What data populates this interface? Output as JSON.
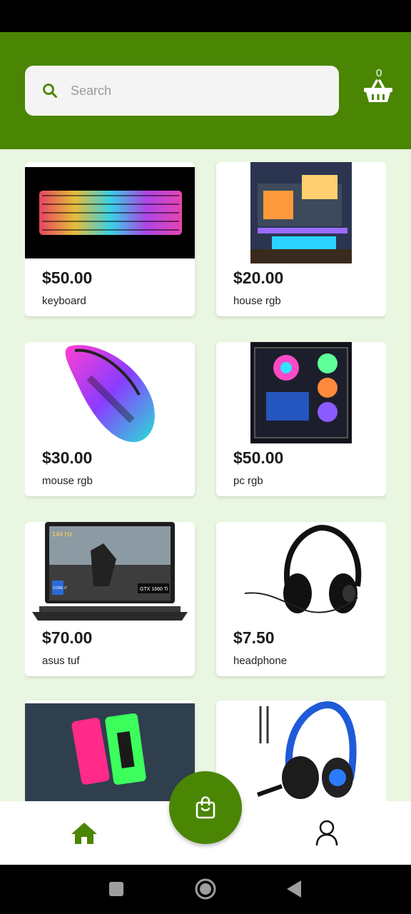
{
  "search": {
    "placeholder": "Search",
    "value": ""
  },
  "cart": {
    "count": "0"
  },
  "products": [
    {
      "price": "$50.00",
      "name": "keyboard"
    },
    {
      "price": "$20.00",
      "name": "house rgb"
    },
    {
      "price": "$30.00",
      "name": "mouse rgb"
    },
    {
      "price": "$50.00",
      "name": "pc rgb"
    },
    {
      "price": "$70.00",
      "name": "asus tuf"
    },
    {
      "price": "$7.50",
      "name": "headphone"
    },
    {
      "price": "",
      "name": ""
    },
    {
      "price": "",
      "name": ""
    }
  ],
  "laptop_screen_labels": {
    "refresh": "144 Hz",
    "gpu": "GTX 1660 Ti",
    "cpu": "CORE i7"
  },
  "colors": {
    "brand": "#4a8604",
    "background": "#e9f6e1"
  },
  "icons": [
    "search-icon",
    "basket-icon",
    "home-icon",
    "shopping-bag-icon",
    "user-icon",
    "recent-apps-icon",
    "home-circle-icon",
    "back-triangle-icon"
  ]
}
